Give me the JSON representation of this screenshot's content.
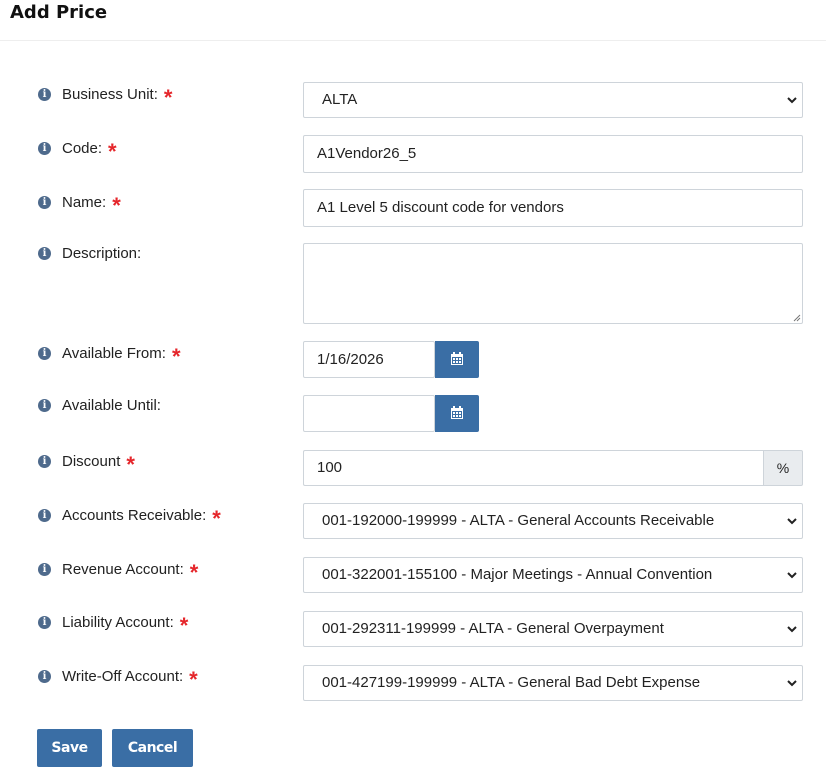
{
  "page": {
    "title": "Add Price"
  },
  "form": {
    "business_unit": {
      "label": "Business Unit:",
      "required": "*",
      "value": "ALTA"
    },
    "code": {
      "label": "Code:",
      "required": "*",
      "value": "A1Vendor26_5"
    },
    "name": {
      "label": "Name:",
      "required": "*",
      "value": "A1 Level 5 discount code for vendors"
    },
    "description": {
      "label": "Description:",
      "value": ""
    },
    "available_from": {
      "label": "Available From:",
      "required": "*",
      "value": "1/16/2026"
    },
    "available_until": {
      "label": "Available Until:",
      "value": ""
    },
    "discount": {
      "label": "Discount",
      "required": "*",
      "value": "100",
      "unit": "%"
    },
    "accounts_receivable": {
      "label": "Accounts Receivable:",
      "required": "*",
      "value": "001-192000-199999 - ALTA - General Accounts Receivable"
    },
    "revenue_account": {
      "label": "Revenue Account:",
      "required": "*",
      "value": "001-322001-155100 - Major Meetings - Annual Convention"
    },
    "liability_account": {
      "label": "Liability Account:",
      "required": "*",
      "value": "001-292311-199999 - ALTA - General Overpayment"
    },
    "write_off_account": {
      "label": "Write-Off Account:",
      "required": "*",
      "value": "001-427199-199999 - ALTA - General Bad Debt Expense"
    }
  },
  "icons": {
    "info": "info-icon",
    "calendar": "calendar-icon",
    "dropdown": "chevron-down-icon"
  },
  "actions": {
    "save_label": "Save",
    "cancel_label": "Cancel"
  },
  "colors": {
    "primary": "#3a6ea5",
    "required": "#e5262b",
    "info_icon": "#4e6a8c"
  }
}
